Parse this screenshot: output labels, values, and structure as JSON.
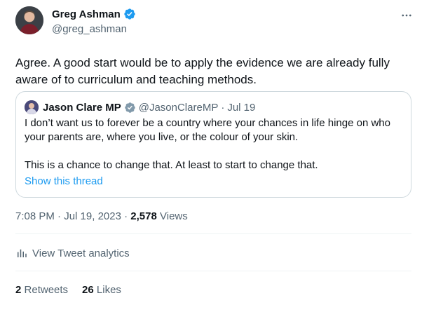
{
  "author": {
    "name": "Greg Ashman",
    "handle": "@greg_ashman",
    "verified": true
  },
  "tweet": {
    "text": "Agree. A good start would be to apply the evidence we are already fully aware of to curriculum and teaching methods."
  },
  "quoted": {
    "name": "Jason Clare MP",
    "handle": "@JasonClareMP",
    "separator": "·",
    "date": "Jul 19",
    "verified": true,
    "paragraph1": "I don’t want us to forever be a country where your chances in life hinge on who your parents are, where you live, or the colour of your skin.",
    "paragraph2": "This is a chance to change that. At least to start to change that.",
    "show_thread": "Show this thread"
  },
  "meta": {
    "time": "7:08 PM",
    "sep1": "·",
    "date": "Jul 19, 2023",
    "sep2": "·",
    "views_count": "2,578",
    "views_label": "Views"
  },
  "analytics": {
    "label": "View Tweet analytics"
  },
  "stats": {
    "retweets_count": "2",
    "retweets_label": "Retweets",
    "likes_count": "26",
    "likes_label": "Likes"
  },
  "colors": {
    "accent": "#1d9bf0",
    "text_primary": "#0f1419",
    "text_secondary": "#536471",
    "border": "#cfd9de",
    "divider": "#eff3f4"
  },
  "icons": {
    "verified": "verified-badge-icon",
    "more": "more-horizontal-icon",
    "analytics": "bar-chart-icon"
  }
}
